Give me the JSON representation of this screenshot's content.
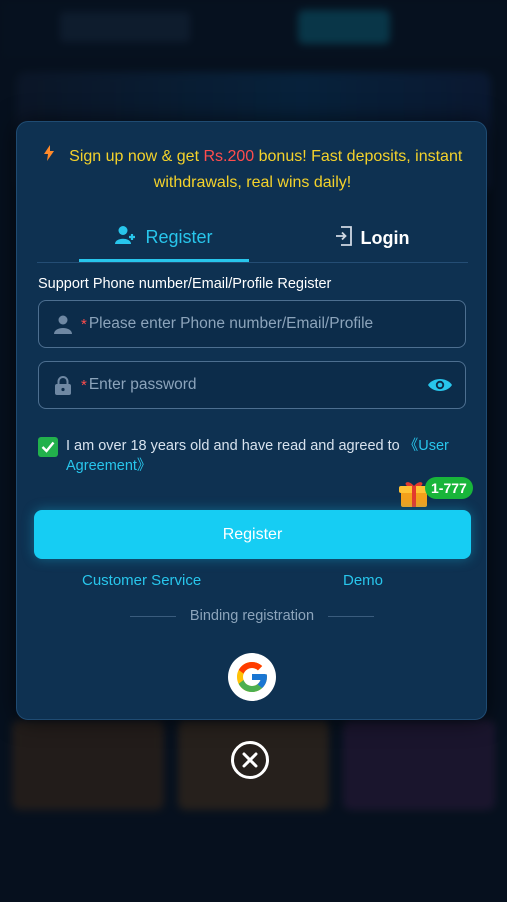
{
  "promo": {
    "prefix": "Sign up now & get ",
    "amount": "Rs.200",
    "suffix": " bonus! Fast deposits, instant withdrawals, real wins daily!"
  },
  "tabs": {
    "register": "Register",
    "login": "Login"
  },
  "form": {
    "support_label": "Support Phone number/Email/Profile Register",
    "required_mark": "*",
    "account_placeholder": "Please enter Phone number/Email/Profile",
    "password_placeholder": "Enter password",
    "agreement_text": "I am over 18 years old and have read and agreed to ",
    "agreement_link": "《User Agreement》",
    "agreed": true
  },
  "bonus_badge": "1-777",
  "register_button": "Register",
  "links": {
    "customer_service": "Customer Service",
    "demo": "Demo"
  },
  "binding_label": "Binding registration",
  "icons": [
    "bolt-icon",
    "user-add-icon",
    "login-door-icon",
    "user-icon",
    "lock-icon",
    "eye-icon",
    "checkmark-icon",
    "gift-icon",
    "google-icon",
    "close-icon"
  ],
  "colors": {
    "accent": "#16cdf3",
    "promo_text": "#f4d22b",
    "amount": "#ff4d4d",
    "check": "#22b14c",
    "modal_bg": "#0e3151"
  }
}
